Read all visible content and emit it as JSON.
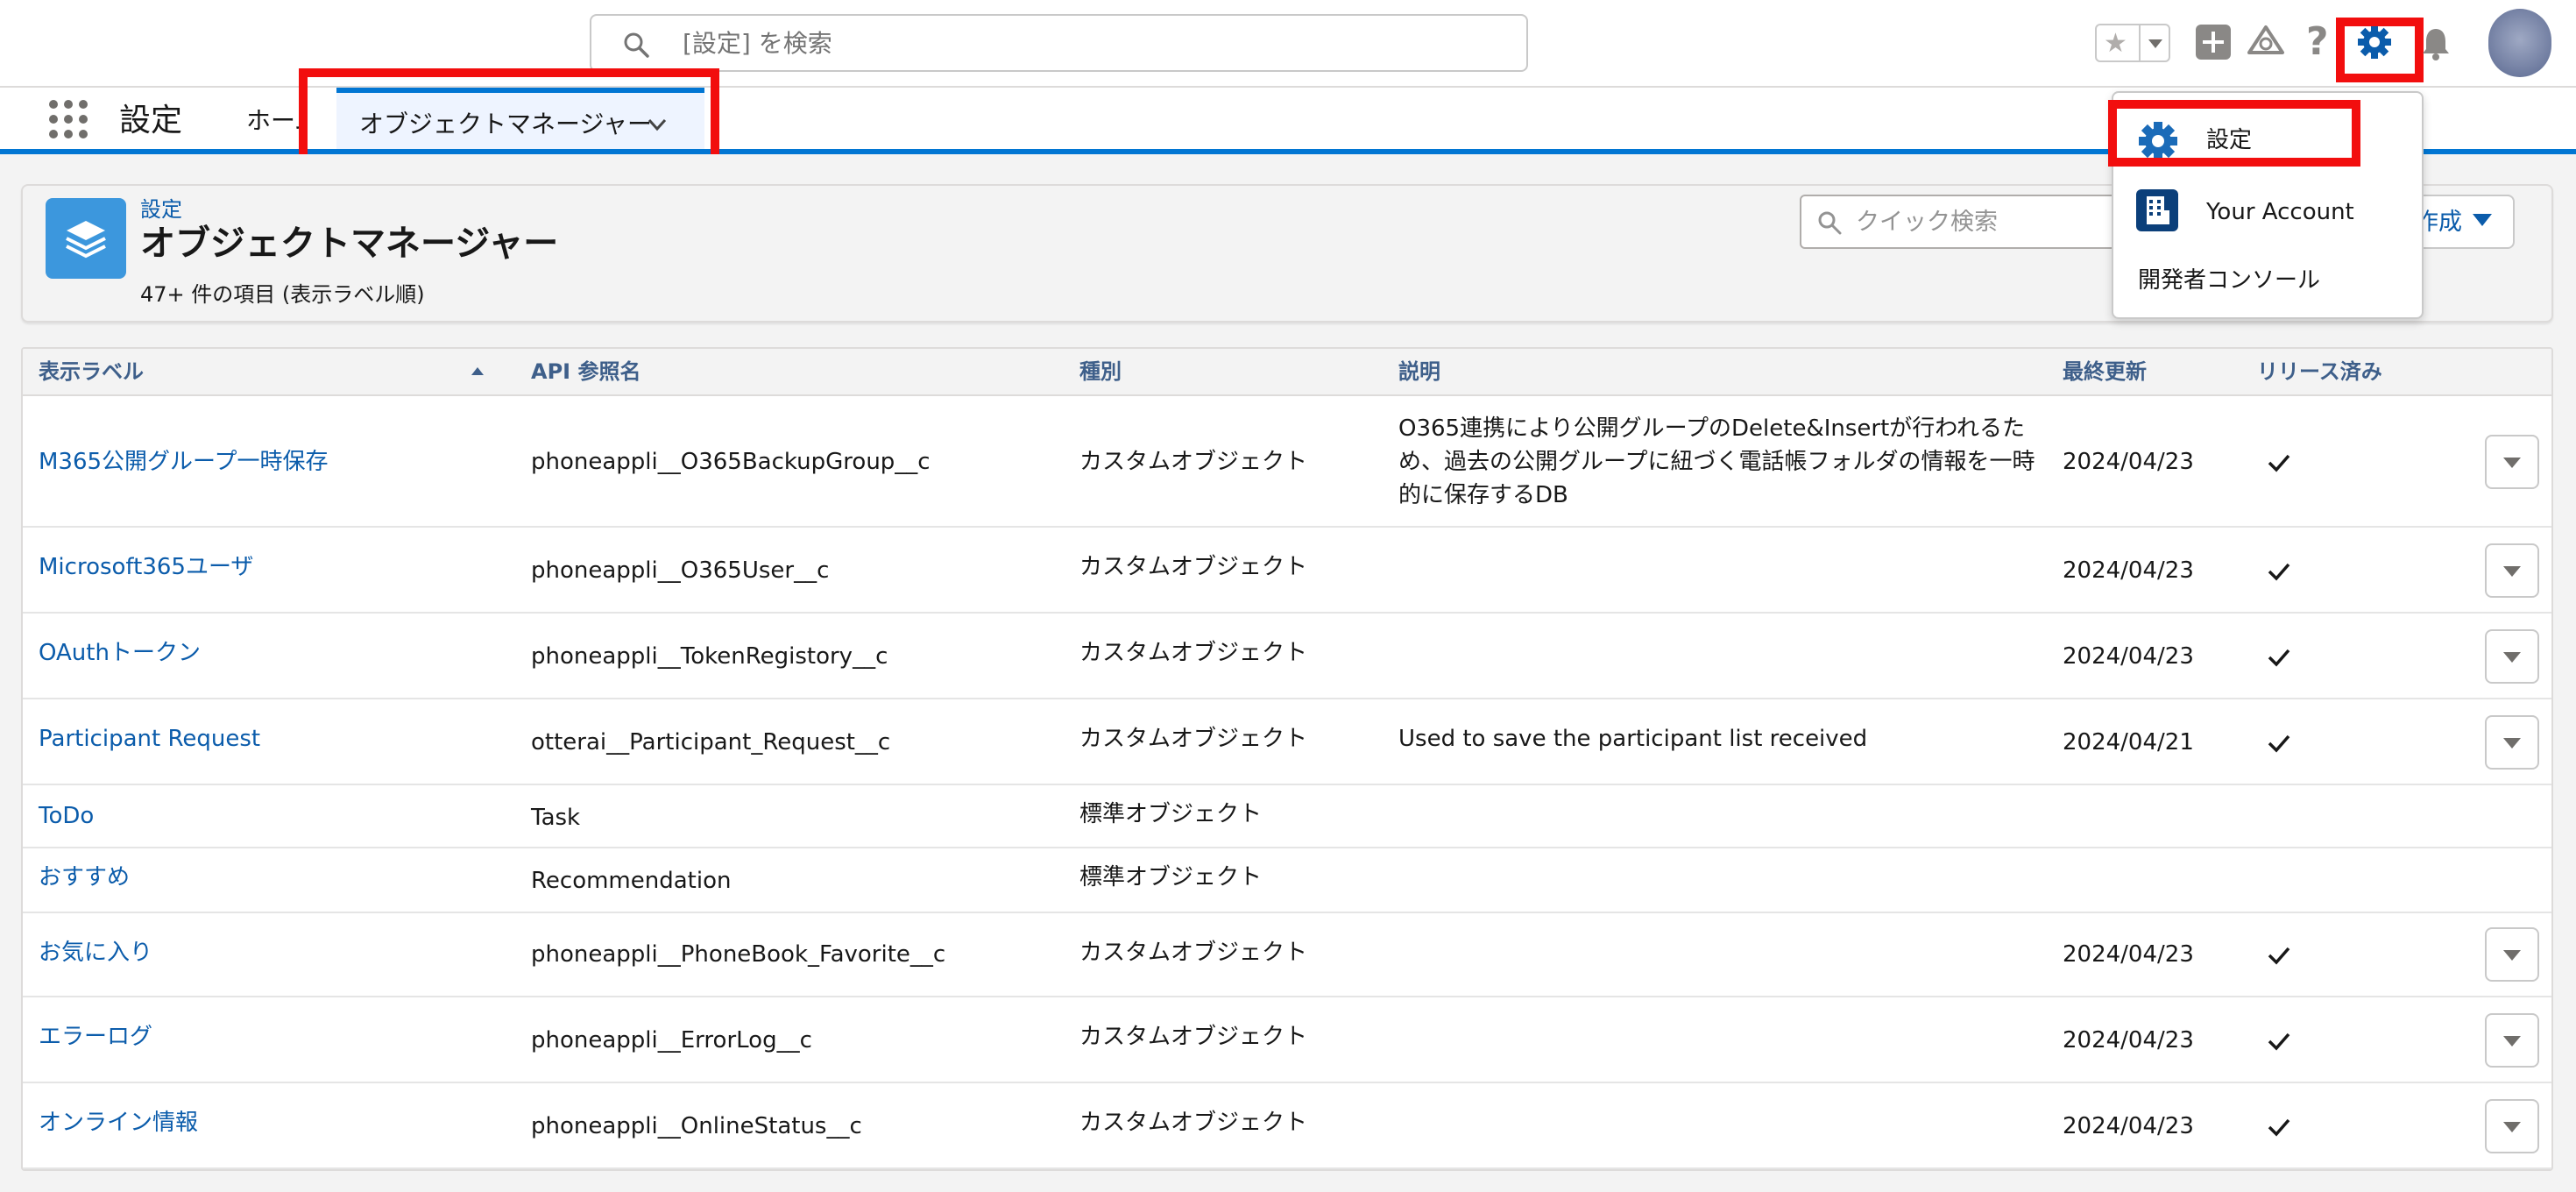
{
  "header": {
    "search_placeholder": "[設定] を検索"
  },
  "nav": {
    "app_name": "設定",
    "home_tab": "ホーム",
    "active_tab": "オブジェクトマネージャー"
  },
  "page_header": {
    "breadcrumb": "設定",
    "title": "オブジェクトマネージャー",
    "count_text": "47+ 件の項目 (表示ラベル順)",
    "quick_find_placeholder": "クイック検索",
    "create_label": "作成"
  },
  "menu": {
    "items": [
      {
        "label": "設定",
        "icon": "gear-icon"
      },
      {
        "label": "Your Account",
        "icon": "building-icon"
      },
      {
        "label": "開発者コンソール",
        "icon": ""
      }
    ]
  },
  "table": {
    "columns": [
      "表示ラベル",
      "API 参照名",
      "種別",
      "説明",
      "最終更新",
      "リリース済み"
    ],
    "sort": {
      "column": "表示ラベル",
      "direction": "ascending"
    },
    "rows": [
      {
        "label": "M365公開グループ一時保存",
        "api": "phoneappli__O365BackupGroup__c",
        "type": "カスタムオブジェクト",
        "desc": "O365連携により公開グループのDelete&Insertが行われるため、過去の公開グループに紐づく電話帳フォルダの情報を一時的に保存するDB",
        "updated": "2024/04/23",
        "deployed": true,
        "has_menu": true
      },
      {
        "label": "Microsoft365ユーザ",
        "api": "phoneappli__O365User__c",
        "type": "カスタムオブジェクト",
        "desc": "",
        "updated": "2024/04/23",
        "deployed": true,
        "has_menu": true
      },
      {
        "label": "OAuthトークン",
        "api": "phoneappli__TokenRegistory__c",
        "type": "カスタムオブジェクト",
        "desc": "",
        "updated": "2024/04/23",
        "deployed": true,
        "has_menu": true
      },
      {
        "label": "Participant Request",
        "api": "otterai__Participant_Request__c",
        "type": "カスタムオブジェクト",
        "desc": "Used to save the participant list received",
        "updated": "2024/04/21",
        "deployed": true,
        "has_menu": true
      },
      {
        "label": "ToDo",
        "api": "Task",
        "type": "標準オブジェクト",
        "desc": "",
        "updated": "",
        "deployed": false,
        "has_menu": false
      },
      {
        "label": "おすすめ",
        "api": "Recommendation",
        "type": "標準オブジェクト",
        "desc": "",
        "updated": "",
        "deployed": false,
        "has_menu": false
      },
      {
        "label": "お気に入り",
        "api": "phoneappli__PhoneBook_Favorite__c",
        "type": "カスタムオブジェクト",
        "desc": "",
        "updated": "2024/04/23",
        "deployed": true,
        "has_menu": true
      },
      {
        "label": "エラーログ",
        "api": "phoneappli__ErrorLog__c",
        "type": "カスタムオブジェクト",
        "desc": "",
        "updated": "2024/04/23",
        "deployed": true,
        "has_menu": true
      },
      {
        "label": "オンライン情報",
        "api": "phoneappli__OnlineStatus__c",
        "type": "カスタムオブジェクト",
        "desc": "",
        "updated": "2024/04/23",
        "deployed": true,
        "has_menu": true
      }
    ]
  },
  "colors": {
    "highlight": "#f20e0e",
    "link": "#0b5cab",
    "brand": "#0176d3"
  }
}
